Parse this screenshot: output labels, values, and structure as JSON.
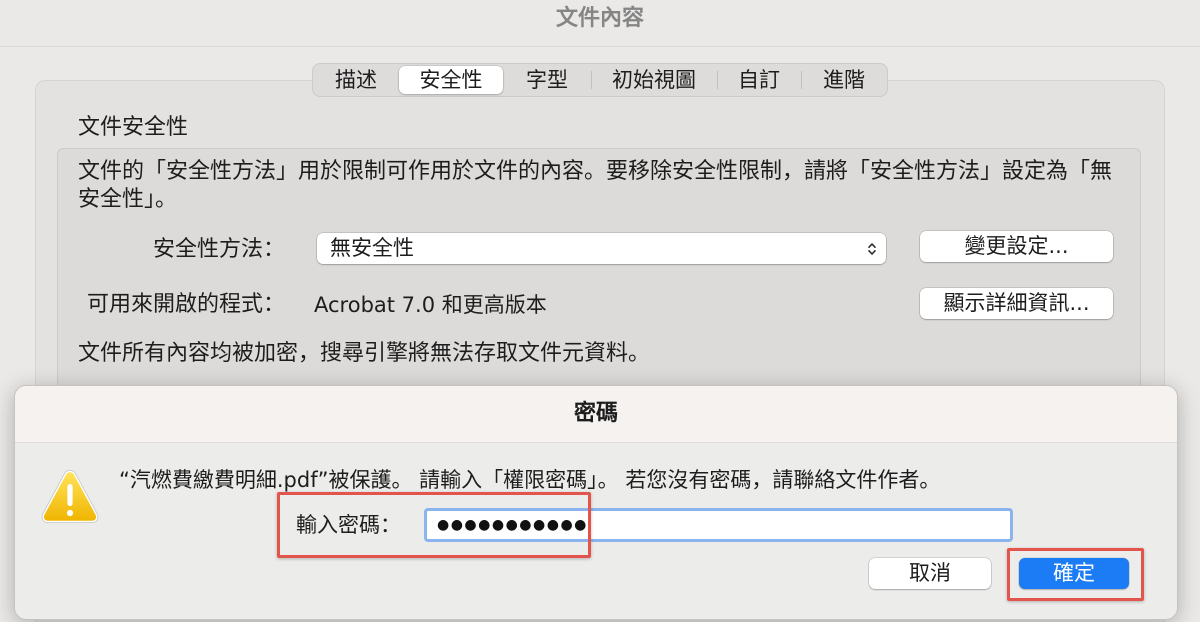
{
  "window": {
    "title": "文件內容"
  },
  "tabs": [
    {
      "label": "描述"
    },
    {
      "label": "安全性",
      "selected": true
    },
    {
      "label": "字型"
    },
    {
      "label": "初始視圖"
    },
    {
      "label": "自訂"
    },
    {
      "label": "進階"
    }
  ],
  "security": {
    "group_title": "文件安全性",
    "description": "文件的「安全性方法」用於限制可作用於文件的內容。要移除安全性限制，請將「安全性方法」設定為「無安全性」。",
    "method_label": "安全性方法：",
    "method_value": "無安全性",
    "change_settings_button": "變更設定...",
    "compat_label": "可用來開啟的程式：",
    "compat_value": "Acrobat 7.0 和更高版本",
    "show_details_button": "顯示詳細資訊...",
    "encryption_note": "文件所有內容均被加密，搜尋引擎將無法存取文件元資料。"
  },
  "password_sheet": {
    "title": "密碼",
    "message": "“汽燃費繳費明細.pdf”被保護。 請輸入「權限密碼」。 若您沒有密碼，請聯絡文件作者。",
    "password_label": "輸入密碼：",
    "password_masked": "●●●●●●●●●●●",
    "cancel_button": "取消",
    "ok_button": "確定"
  },
  "icons": {
    "warning": "warning-icon",
    "popup_chevron": "updown-chevron-icon"
  },
  "colors": {
    "accent": "#1b7cf5",
    "highlight": "#e2554c",
    "warning": "#f6c21b"
  }
}
